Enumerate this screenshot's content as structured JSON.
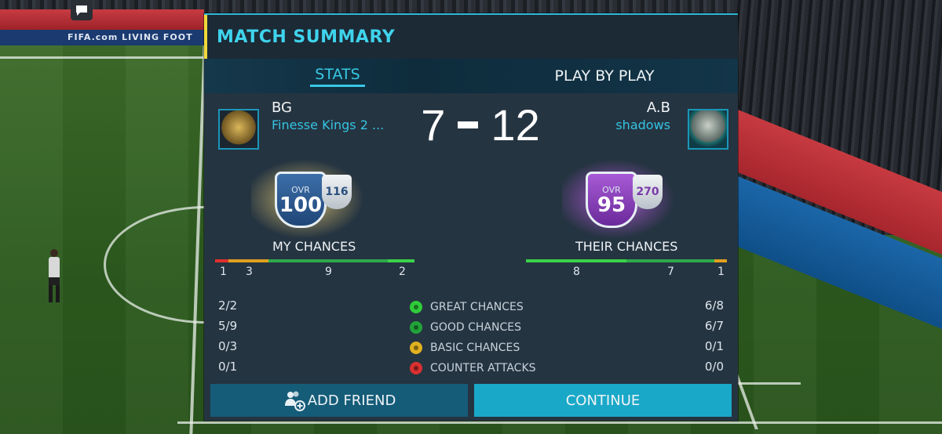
{
  "background": {
    "banner_text": "FIFA.com   LIVING FOOT"
  },
  "header": {
    "title": "MATCH SUMMARY"
  },
  "tabs": [
    {
      "label": "STATS",
      "active": true
    },
    {
      "label": "PLAY BY PLAY",
      "active": false
    }
  ],
  "my_team": {
    "name": "BG",
    "club": "Finesse Kings 2 ...",
    "ovr_label": "OVR",
    "ovr": "100",
    "secondary_rating": "116",
    "chances_label": "MY CHANCES",
    "chance_segments": [
      1,
      3,
      9,
      2
    ]
  },
  "their_team": {
    "name": "A.B",
    "club": "shadows",
    "ovr_label": "OVR",
    "ovr": "95",
    "secondary_rating": "270",
    "chances_label": "THEIR CHANCES",
    "chance_segments": [
      8,
      7,
      1
    ]
  },
  "score": {
    "home": "7",
    "away": "12"
  },
  "stats": [
    {
      "label": "GREAT CHANCES",
      "mine": "2/2",
      "theirs": "6/8",
      "icon": "green-ball-icon",
      "color": "#2ecc3a"
    },
    {
      "label": "GOOD CHANCES",
      "mine": "5/9",
      "theirs": "6/7",
      "icon": "darkgreen-ball-icon",
      "color": "#21a33a"
    },
    {
      "label": "BASIC CHANCES",
      "mine": "0/3",
      "theirs": "0/1",
      "icon": "yellow-ball-icon",
      "color": "#e0b020"
    },
    {
      "label": "COUNTER ATTACKS",
      "mine": "0/1",
      "theirs": "0/0",
      "icon": "red-ball-icon",
      "color": "#d93030"
    }
  ],
  "buttons": {
    "add_friend": "ADD FRIEND",
    "continue": "CONTINUE"
  },
  "colors": {
    "accent": "#38c8e4",
    "header_bar": "#f0d83a",
    "counter": "#e0302c",
    "basic": "#e0a020",
    "good": "#2ea84a",
    "great": "#3ad24a"
  }
}
